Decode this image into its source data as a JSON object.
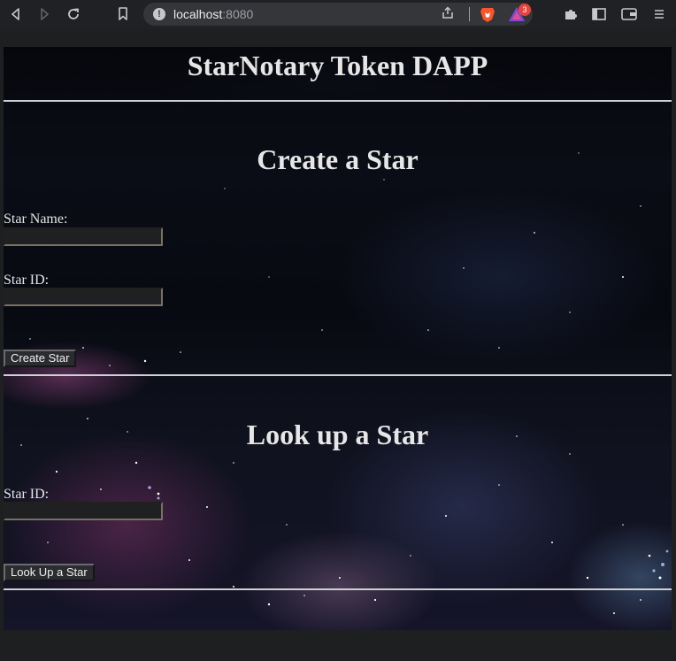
{
  "browser": {
    "url_host": "localhost",
    "url_port": ":8080",
    "rewards_badge": "3"
  },
  "app": {
    "title": "StarNotary Token DAPP"
  },
  "create_section": {
    "title": "Create a Star",
    "name_label": "Star Name:",
    "name_value": "",
    "id_label": "Star ID:",
    "id_value": "",
    "button_label": "Create Star"
  },
  "lookup_section": {
    "title": "Look up a Star",
    "id_label": "Star ID:",
    "id_value": "",
    "button_label": "Look Up a Star"
  }
}
